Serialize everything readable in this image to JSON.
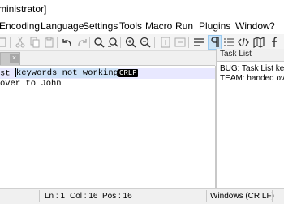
{
  "window": {
    "title": "ministrator]"
  },
  "menu": {
    "items": [
      "Encoding",
      "Language",
      "Settings",
      "Tools",
      "Macro",
      "Run",
      "Plugins",
      "Window",
      "?"
    ]
  },
  "editor": {
    "line1": {
      "before": "st ",
      "selected": "keywords not working",
      "eol": "CRLF"
    },
    "line2": {
      "text": "over to John"
    }
  },
  "task_panel": {
    "title": "Task List",
    "items": [
      "BUG: Task List keyw",
      "TEAM: handed over"
    ]
  },
  "status": {
    "ln": "Ln : 1",
    "col": "Col : 16",
    "pos": "Pos : 16",
    "eol_format": "Windows (CR LF)"
  },
  "icons": {
    "toolbar": [
      "close-all-icon",
      "cut-icon",
      "copy-icon",
      "paste-icon",
      "undo-icon",
      "redo-icon",
      "find-icon",
      "replace-icon",
      "zoom-in-icon",
      "zoom-out-icon",
      "sync-vertical-icon",
      "sync-horizontal-icon",
      "word-wrap-icon",
      "show-all-chars-icon",
      "indent-guide-icon",
      "xml-tag-icon",
      "document-map-icon",
      "function-list-icon"
    ]
  },
  "colors": {
    "selection": "#cfe2f7",
    "current_line": "#e8e8ff",
    "active_toggle": "#cce4f7"
  }
}
